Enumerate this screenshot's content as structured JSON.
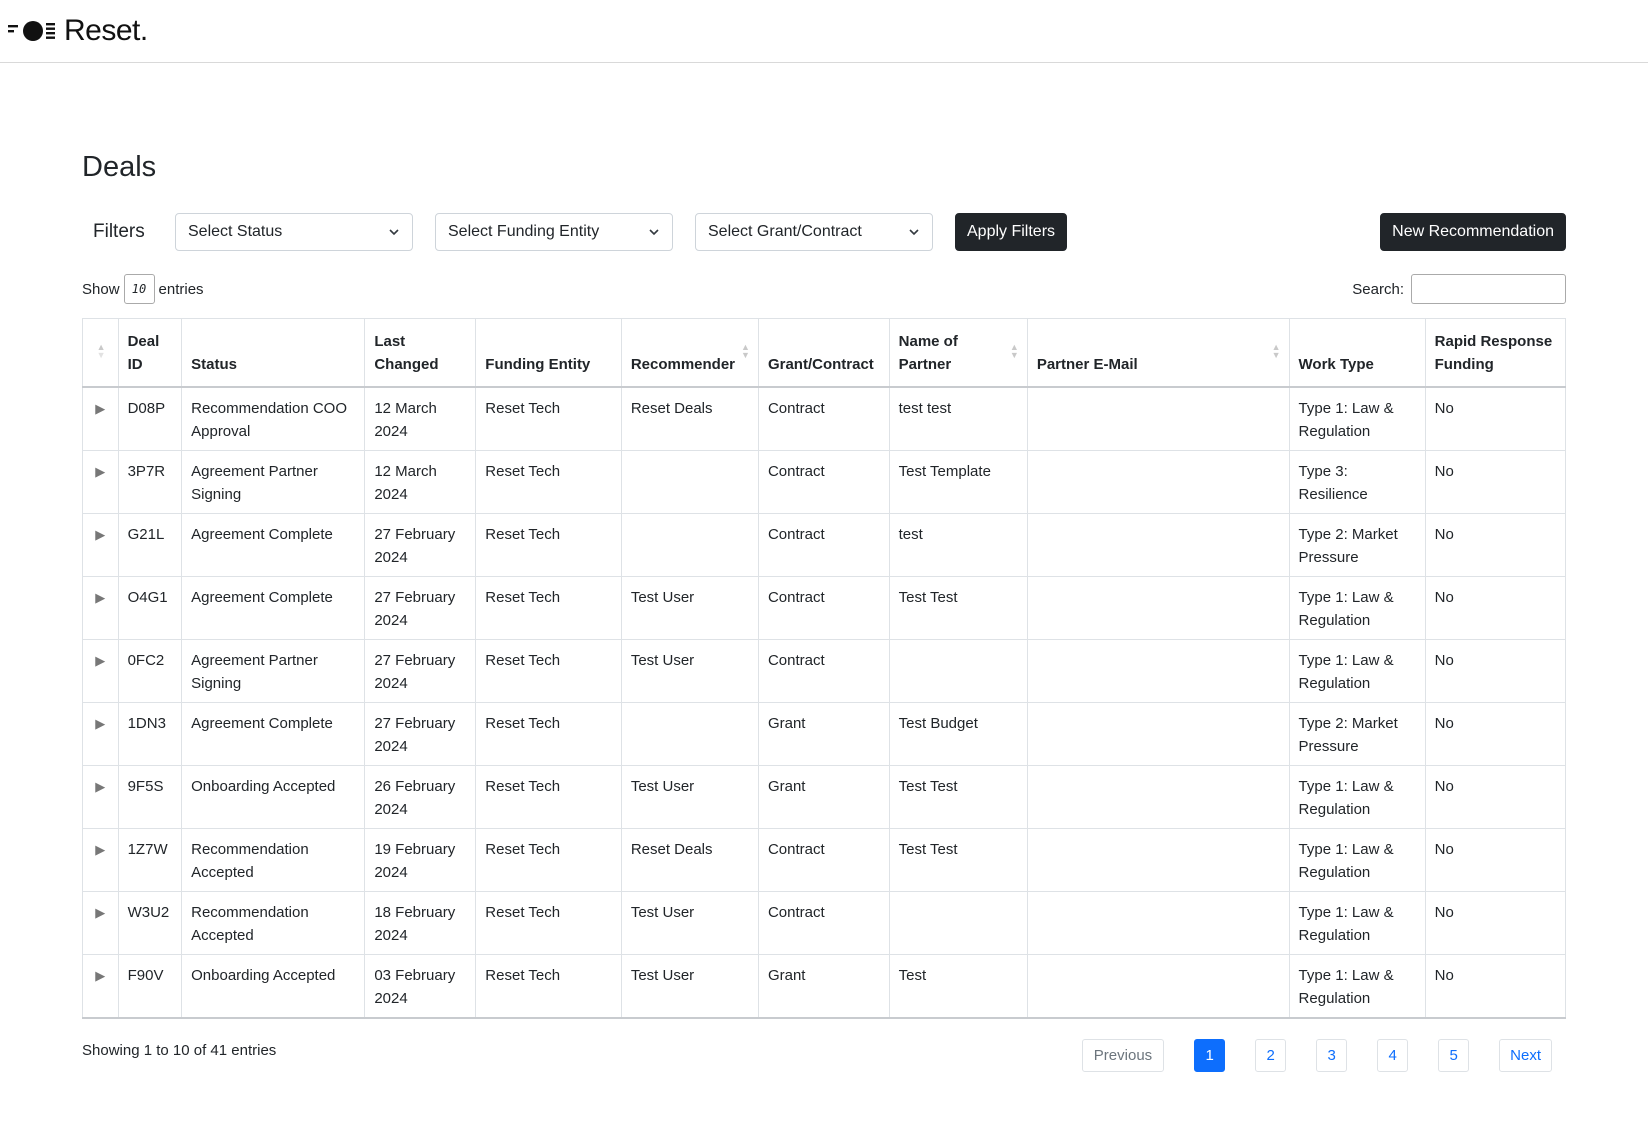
{
  "brand": {
    "name": "Reset."
  },
  "page": {
    "title": "Deals"
  },
  "filters": {
    "label": "Filters",
    "status_placeholder": "Select Status",
    "funding_placeholder": "Select Funding Entity",
    "grant_placeholder": "Select Grant/Contract",
    "apply_label": "Apply Filters",
    "new_label": "New Recommendation"
  },
  "length": {
    "show_label": "Show",
    "value": "10",
    "entries_label": "entries"
  },
  "search": {
    "label": "Search:"
  },
  "table": {
    "headers": {
      "deal_id_1": "Deal",
      "deal_id_2": "ID",
      "status": "Status",
      "last_changed_1": "Last",
      "last_changed_2": "Changed",
      "funding": "Funding Entity",
      "recommender": "Recommender",
      "grant": "Grant/Contract",
      "partner_1": "Name of",
      "partner_2": "Partner",
      "email": "Partner E-Mail",
      "work_type": "Work Type",
      "rapid_1": "Rapid Response",
      "rapid_2": "Funding"
    },
    "rows": [
      {
        "id": "D08P",
        "status": "Recommendation COO Approval",
        "changed": "12 March 2024",
        "funding": "Reset Tech",
        "recommender": "Reset Deals",
        "grant": "Contract",
        "partner": "test test",
        "email": "",
        "work_type": "Type 1: Law & Regulation",
        "rapid": "No"
      },
      {
        "id": "3P7R",
        "status": "Agreement Partner Signing",
        "changed": "12 March 2024",
        "funding": "Reset Tech",
        "recommender": "",
        "grant": "Contract",
        "partner": "Test Template",
        "email": "",
        "work_type": "Type 3: Resilience",
        "rapid": "No"
      },
      {
        "id": "G21L",
        "status": "Agreement Complete",
        "changed": "27 February 2024",
        "funding": "Reset Tech",
        "recommender": "",
        "grant": "Contract",
        "partner": "test",
        "email": "",
        "work_type": "Type 2: Market Pressure",
        "rapid": "No"
      },
      {
        "id": "O4G1",
        "status": "Agreement Complete",
        "changed": "27 February 2024",
        "funding": "Reset Tech",
        "recommender": "Test User",
        "grant": "Contract",
        "partner": "Test Test",
        "email": "",
        "work_type": "Type 1: Law & Regulation",
        "rapid": "No"
      },
      {
        "id": "0FC2",
        "status": "Agreement Partner Signing",
        "changed": "27 February 2024",
        "funding": "Reset Tech",
        "recommender": "Test User",
        "grant": "Contract",
        "partner": "",
        "email": "",
        "work_type": "Type 1: Law & Regulation",
        "rapid": "No"
      },
      {
        "id": "1DN3",
        "status": "Agreement Complete",
        "changed": "27 February 2024",
        "funding": "Reset Tech",
        "recommender": "",
        "grant": "Grant",
        "partner": "Test Budget",
        "email": "",
        "work_type": "Type 2: Market Pressure",
        "rapid": "No"
      },
      {
        "id": "9F5S",
        "status": "Onboarding Accepted",
        "changed": "26 February 2024",
        "funding": "Reset Tech",
        "recommender": "Test User",
        "grant": "Grant",
        "partner": "Test Test",
        "email": "",
        "work_type": "Type 1: Law & Regulation",
        "rapid": "No"
      },
      {
        "id": "1Z7W",
        "status": "Recommendation Accepted",
        "changed": "19 February 2024",
        "funding": "Reset Tech",
        "recommender": "Reset Deals",
        "grant": "Contract",
        "partner": "Test Test",
        "email": "",
        "work_type": "Type 1: Law & Regulation",
        "rapid": "No"
      },
      {
        "id": "W3U2",
        "status": "Recommendation Accepted",
        "changed": "18 February 2024",
        "funding": "Reset Tech",
        "recommender": "Test User",
        "grant": "Contract",
        "partner": "",
        "email": "",
        "work_type": "Type 1: Law & Regulation",
        "rapid": "No"
      },
      {
        "id": "F90V",
        "status": "Onboarding Accepted",
        "changed": "03 February 2024",
        "funding": "Reset Tech",
        "recommender": "Test User",
        "grant": "Grant",
        "partner": "Test",
        "email": "",
        "work_type": "Type 1: Law & Regulation",
        "rapid": "No"
      }
    ]
  },
  "footer": {
    "info": "Showing 1 to 10 of 41 entries",
    "previous": "Previous",
    "next": "Next",
    "pages": [
      "1",
      "2",
      "3",
      "4",
      "5"
    ],
    "current_page": "1"
  },
  "colors": {
    "primary": "#0d6efd",
    "dark_button": "#212529"
  }
}
